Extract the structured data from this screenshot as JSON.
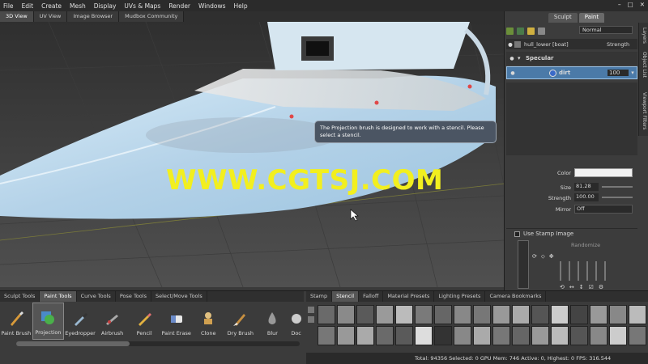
{
  "menubar": {
    "items": [
      "File",
      "Edit",
      "Create",
      "Mesh",
      "Display",
      "UVs & Maps",
      "Render",
      "Windows",
      "Help"
    ]
  },
  "viewtabs": [
    "3D View",
    "UV View",
    "Image Browser",
    "Mudbox Community"
  ],
  "tooltip": "The Projection brush is designed to work with a stencil. Please select a stencil.",
  "watermark": "WWW.CGTSJ.COM",
  "rightpanel": {
    "tabs": [
      "Sculpt",
      "Paint"
    ],
    "blend_mode": "Normal",
    "layer_header_name": "hull_lower [boat]",
    "layer_header_strength": "Strength",
    "group_name": "Specular",
    "layer_name": "dirt",
    "layer_value": "100",
    "side_tabs": [
      "Layers",
      "Object List",
      "Viewport Filters"
    ],
    "props": {
      "color_label": "Color",
      "size_label": "Size",
      "size_value": "81.28",
      "strength_label": "Strength",
      "strength_value": "100.00",
      "mirror_label": "Mirror",
      "mirror_value": "Off"
    },
    "stamp_label": "Use Stamp Image",
    "randomize_label": "Randomize"
  },
  "tool_tabs": [
    "Sculpt Tools",
    "Paint Tools",
    "Curve Tools",
    "Pose Tools",
    "Select/Move Tools"
  ],
  "tools": [
    "Paint Brush",
    "Projection",
    "Eyedropper",
    "Airbrush",
    "Pencil",
    "Paint Erase",
    "Clone",
    "Dry Brush",
    "Blur",
    "Doc"
  ],
  "stamp_tabs": [
    "Stamp",
    "Stencil",
    "Falloff",
    "Material Presets",
    "Lighting Presets",
    "Camera Bookmarks"
  ],
  "status": "Total: 94356  Selected: 0 GPU Mem: 746  Active: 0, Highest: 0  FPS: 316.544",
  "colors": {
    "model": "#bcd6ea",
    "watermark": "#f2ef1f",
    "selection": "#4b7aa8"
  }
}
